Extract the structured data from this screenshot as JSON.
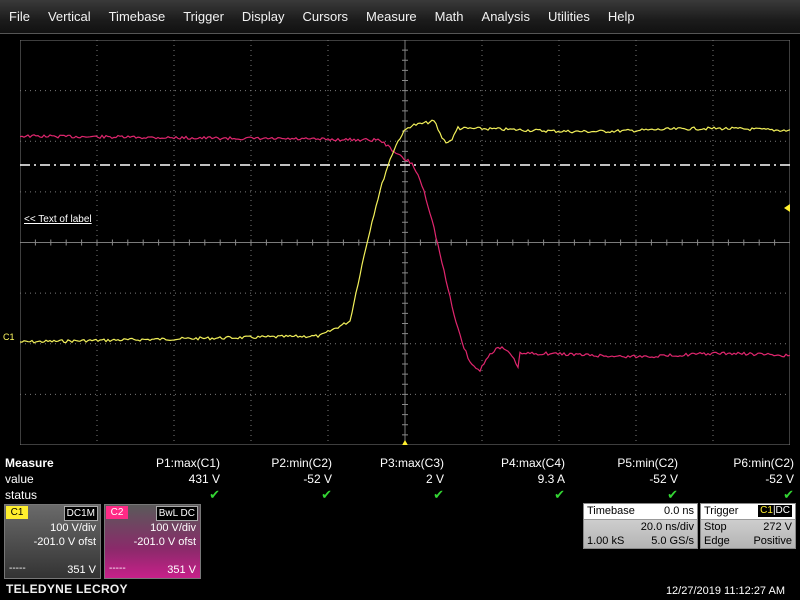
{
  "menu": [
    "File",
    "Vertical",
    "Timebase",
    "Trigger",
    "Display",
    "Cursors",
    "Measure",
    "Math",
    "Analysis",
    "Utilities",
    "Help"
  ],
  "plot": {
    "label_text": "<< Text of label",
    "c1_marker": "C1",
    "trace_colors": {
      "c1": "#f2f05a",
      "c2": "#e0266e",
      "grid": "#7b7b7b",
      "trigger_level": "#ffffff"
    }
  },
  "measure": {
    "title": "Measure",
    "row_value": "value",
    "row_status": "status",
    "params": [
      {
        "name": "P1:max(C1)",
        "value": "431 V",
        "status": "✔"
      },
      {
        "name": "P2:min(C2)",
        "value": "-52 V",
        "status": "✔"
      },
      {
        "name": "P3:max(C3)",
        "value": "2 V",
        "status": "✔"
      },
      {
        "name": "P4:max(C4)",
        "value": "9.3 A",
        "status": "✔"
      },
      {
        "name": "P5:min(C2)",
        "value": "-52 V",
        "status": "✔"
      },
      {
        "name": "P6:min(C2)",
        "value": "-52 V",
        "status": "✔"
      }
    ]
  },
  "channels": {
    "c1": {
      "tag": "C1",
      "coupling": "DC1M",
      "vdiv": "100 V/div",
      "offset": "-201.0 V ofst",
      "level": "351 V",
      "dash": "-----"
    },
    "c2": {
      "tag": "C2",
      "coupling": "BwL DC",
      "vdiv": "100 V/div",
      "offset": "-201.0 V ofst",
      "level": "351 V",
      "dash": "-----"
    }
  },
  "timebase": {
    "label": "Timebase",
    "delay": "0.0 ns",
    "tdiv": "20.0 ns/div",
    "samples": "1.00 kS",
    "rate": "5.0 GS/s"
  },
  "trigger": {
    "label": "Trigger",
    "src": "C1",
    "coupling": "DC",
    "mode": "Stop",
    "level": "272 V",
    "type": "Edge",
    "slope": "Positive"
  },
  "brand": "TELEDYNE LECROY",
  "timestamp": "12/27/2019 11:12:27 AM"
}
